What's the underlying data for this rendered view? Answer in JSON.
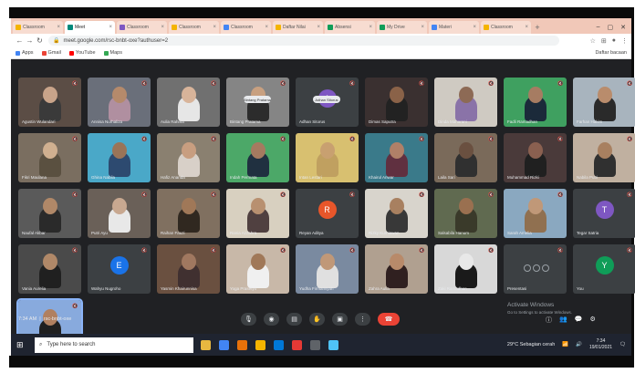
{
  "browser": {
    "tabs": [
      {
        "label": "Classroom",
        "favicon_color": "#f4b400",
        "active": false
      },
      {
        "label": "Meet",
        "favicon_color": "#00897b",
        "active": true
      },
      {
        "label": "Classroom",
        "favicon_color": "#7e57c2",
        "active": false
      },
      {
        "label": "Classroom",
        "favicon_color": "#f4b400",
        "active": false
      },
      {
        "label": "Classroom",
        "favicon_color": "#4285f4",
        "active": false
      },
      {
        "label": "Daftar Nilai",
        "favicon_color": "#f4b400",
        "active": false
      },
      {
        "label": "Absensi",
        "favicon_color": "#0f9d58",
        "active": false
      },
      {
        "label": "My Drive",
        "favicon_color": "#0f9d58",
        "active": false
      },
      {
        "label": "Materi",
        "favicon_color": "#4285f4",
        "active": false
      },
      {
        "label": "Classroom",
        "favicon_color": "#f4b400",
        "active": false
      }
    ],
    "url": "meet.google.com/rsc-bnbt-oxe?authuser=2",
    "bookmarks": [
      {
        "label": "Apps",
        "color": "#4285f4"
      },
      {
        "label": "Gmail",
        "color": "#ea4335"
      },
      {
        "label": "YouTube",
        "color": "#ff0000"
      },
      {
        "label": "Maps",
        "color": "#34a853"
      }
    ],
    "bookmarks_right": "Daftar bacaan"
  },
  "meet": {
    "tiles": [
      {
        "name": "Agustin Wulandari",
        "bg": "#5b4d45",
        "skin": "#c9a48a",
        "cloth": "#3a3a3a"
      },
      {
        "name": "Annisa Nurhaliza",
        "bg": "#6a6f7a",
        "skin": "#b58a6b",
        "cloth": "#b08fa0"
      },
      {
        "name": "Aulia Rahma",
        "bg": "#707070",
        "skin": "#d8b49a",
        "cloth": "#e6e6e6"
      },
      {
        "name": "Bintang Pratama",
        "bg": "#858585",
        "skin": "#c8a080",
        "cloth": "#2c2c2c",
        "pill": "Bintang Pratama"
      },
      {
        "name": "Adhan Sitorus",
        "bg": "#3c4043",
        "avatar": "A",
        "avatar_color": "#7e57c2",
        "pill": "Adhan Sitorus"
      },
      {
        "name": "Dimas Saputra",
        "bg": "#3a3030",
        "skin": "#8a6248",
        "cloth": "#222222"
      },
      {
        "name": "Dinda Maharani",
        "bg": "#cfcac2",
        "skin": "#8d6a55",
        "cloth": "#8a73a8"
      },
      {
        "name": "Fadli Ramadhan",
        "bg": "#3fa060",
        "skin": "#a67c62",
        "cloth": "#1b2a3a"
      },
      {
        "name": "Farhan Hakim",
        "bg": "#a8b4be",
        "skin": "#b98c6c",
        "cloth": "#2a2a2a"
      },
      {
        "name": "Fikri Maulana",
        "bg": "#7a6e60",
        "skin": "#d0b090",
        "cloth": "#5a5040"
      },
      {
        "name": "Ghina Nabila",
        "bg": "#4aa8c8",
        "skin": "#9a7458",
        "cloth": "#2d4a70"
      },
      {
        "name": "Hafiz Ananda",
        "bg": "#8a8070",
        "skin": "#c89e80",
        "cloth": "#d8d0c8"
      },
      {
        "name": "Indah Permata",
        "bg": "#4ca868",
        "skin": "#a57a60",
        "cloth": "#203040"
      },
      {
        "name": "Intan Lestari",
        "bg": "#d8c070",
        "skin": "#c8a070",
        "cloth": "#c0a060"
      },
      {
        "name": "Khairul Anwar",
        "bg": "#3a7a8a",
        "skin": "#b08068",
        "cloth": "#603040"
      },
      {
        "name": "Laila Sari",
        "bg": "#7a6a5a",
        "skin": "#6a5040",
        "cloth": "#303030"
      },
      {
        "name": "Muhammad Rizki",
        "bg": "#4a3a3a",
        "skin": "#8a6050",
        "cloth": "#202020"
      },
      {
        "name": "Nabila Putri",
        "bg": "#c0b0a0",
        "skin": "#a88060",
        "cloth": "#303030"
      },
      {
        "name": "Naufal Akbar",
        "bg": "#5a5a5a",
        "skin": "#b08868",
        "cloth": "#2a2a2a"
      },
      {
        "name": "Putri Ayu",
        "bg": "#6a6058",
        "skin": "#c8a890",
        "cloth": "#e8e8e8"
      },
      {
        "name": "Raihan Fauzi",
        "bg": "#807060",
        "skin": "#a07858",
        "cloth": "#302820"
      },
      {
        "name": "Rania Azzahra",
        "bg": "#d8d0c0",
        "skin": "#b89070",
        "cloth": "#504040"
      },
      {
        "name": "Reyan Aditya",
        "bg": "#3c4043",
        "avatar": "R",
        "avatar_color": "#e8562a"
      },
      {
        "name": "Rizky Kurniawan",
        "bg": "#d8d4cc",
        "skin": "#a88060",
        "cloth": "#383838"
      },
      {
        "name": "Salsabila Hanum",
        "bg": "#606a50",
        "skin": "#9a7050",
        "cloth": "#3a3a2a"
      },
      {
        "name": "Sarah Amelia",
        "bg": "#8aa8c0",
        "skin": "#c09878",
        "cloth": "#907050"
      },
      {
        "name": "Tegar Satria",
        "bg": "#3c4043",
        "avatar": "T",
        "avatar_color": "#7e57c2"
      },
      {
        "name": "Vania Aurelia",
        "bg": "#4a4a4a",
        "skin": "#b08868",
        "cloth": "#202020"
      },
      {
        "name": "Wahyu Nugroho",
        "bg": "#3c4043",
        "avatar": "E",
        "avatar_color": "#1a73e8"
      },
      {
        "name": "Yasmin Khairunnisa",
        "bg": "#6a5040",
        "skin": "#a07860",
        "cloth": "#403030"
      },
      {
        "name": "Yoga Prasetyo",
        "bg": "#c8b8a8",
        "skin": "#a07858",
        "cloth": "#f0f0f0"
      },
      {
        "name": "Yudha Firmansyah",
        "bg": "#7a8aa0",
        "skin": "#c09878",
        "cloth": "#e0e0e0"
      },
      {
        "name": "Zahra Aulia",
        "bg": "#b0a090",
        "skin": "#b88a6a",
        "cloth": "#302020"
      },
      {
        "name": "Zaki Ramadhan",
        "bg": "#d8d8d8",
        "skin": "#e8e8e8",
        "cloth": "#1a1a1a"
      },
      {
        "name": "Presentasi",
        "bg": "#3c4043",
        "controls": true
      },
      {
        "name": "You",
        "bg": "#3c4043",
        "avatar": "Y",
        "avatar_color": "#0f9d58"
      },
      {
        "name": "You",
        "bg": "#88aadd",
        "skin": "#b08060",
        "cloth": "#202020",
        "self": true
      }
    ],
    "time": "7:34 AM",
    "meeting_code": "rsc-bnbt-oxe",
    "controls": [
      "mic",
      "camera",
      "captions",
      "raise-hand",
      "present",
      "more"
    ],
    "activate_title": "Activate Windows",
    "activate_sub": "Go to Settings to activate Windows."
  },
  "taskbar": {
    "search_placeholder": "Type here to search",
    "weather": "29°C  Sebagian cerah",
    "time": "7:34",
    "date": "19/01/2021",
    "apps": [
      "#e8b840",
      "#4285f4",
      "#e8710a",
      "#f4b400",
      "#0078d7",
      "#e53935",
      "#5f6368",
      "#4fc3f7"
    ]
  }
}
